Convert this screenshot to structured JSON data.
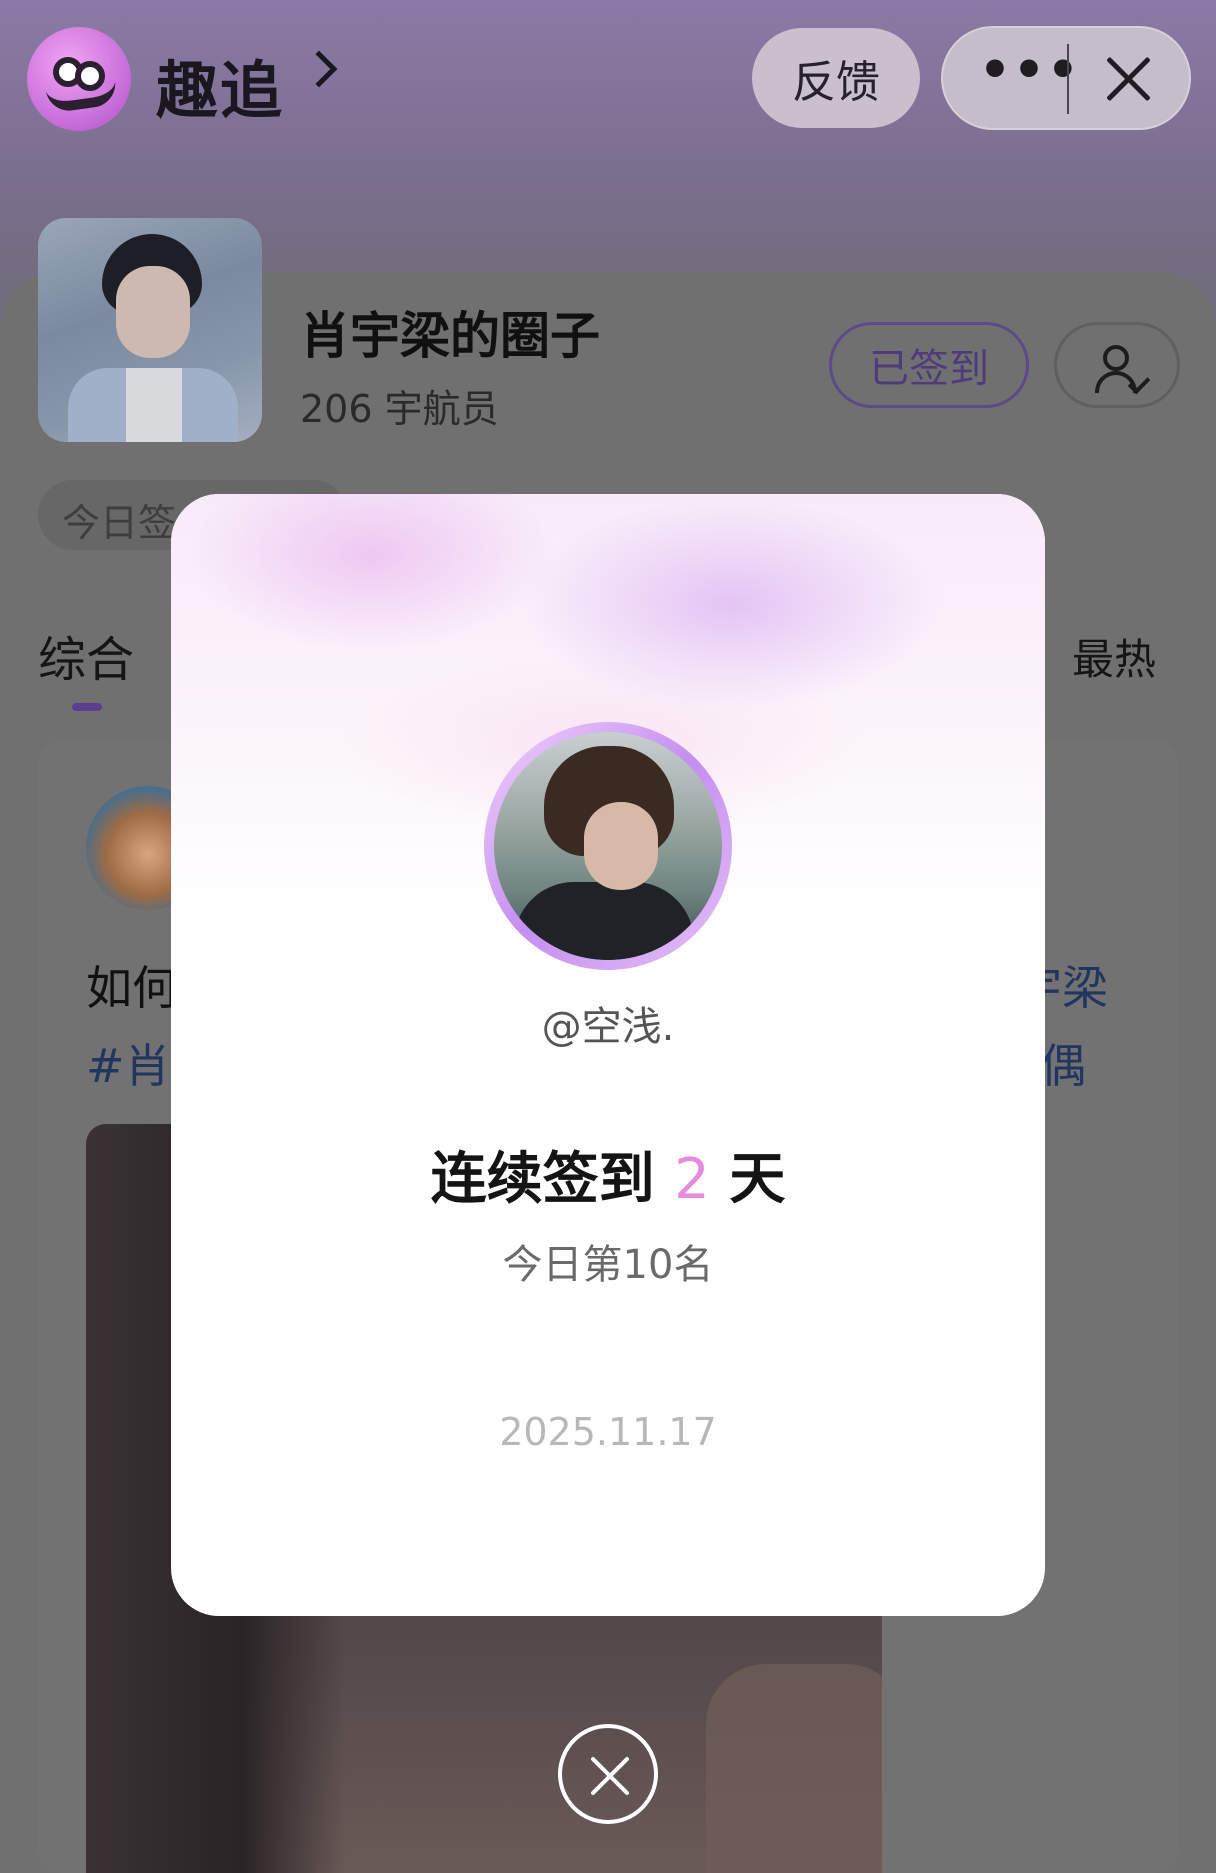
{
  "app": {
    "name": "趣追",
    "logo_icon": "quzhui-logo-icon"
  },
  "topbar": {
    "feedback_label": "反馈",
    "more_icon": "more-dots-icon",
    "close_icon": "close-icon",
    "more_glyph": "•••"
  },
  "circle": {
    "title": "肖宇梁的圈子",
    "members": "206 宇航员",
    "signed_label": "已签到",
    "profile_icon": "user-check-icon",
    "today_pill": "今日签"
  },
  "tabs": {
    "all": "综合",
    "hot": "最热"
  },
  "post": {
    "line1_left": "如何",
    "line2_left": "#肖",
    "line1_right": "宇梁",
    "line2_right": "偶"
  },
  "modal": {
    "username": "@空浅.",
    "streak_prefix": "连续签到",
    "streak_days": "2",
    "streak_suffix": "天",
    "rank": "今日第10名",
    "date": "2025.11.17",
    "close_icon": "circle-close-icon"
  },
  "colors": {
    "accent": "#e88be0",
    "signed_text": "#4f3b7a",
    "tab_indicator": "#5b3f8e"
  }
}
